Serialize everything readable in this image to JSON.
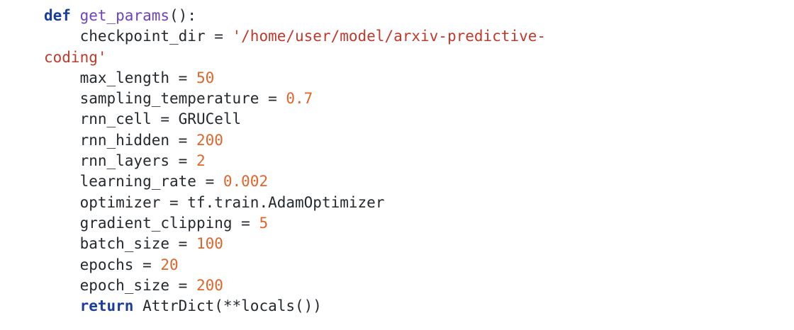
{
  "editor": {
    "lines": [
      {
        "indent": "",
        "tokens": [
          {
            "type": "kw",
            "text": "def"
          },
          {
            "type": "plain",
            "text": " "
          },
          {
            "type": "fn",
            "text": "get_params"
          },
          {
            "type": "plain",
            "text": "():"
          }
        ]
      },
      {
        "indent": "    ",
        "tokens": [
          {
            "type": "plain",
            "text": "checkpoint_dir = "
          },
          {
            "type": "str",
            "text": "'/home/user/model/arxiv-predictive-"
          }
        ]
      },
      {
        "indent": "",
        "tokens": [
          {
            "type": "str",
            "text": "coding'"
          }
        ]
      },
      {
        "indent": "    ",
        "tokens": [
          {
            "type": "plain",
            "text": "max_length = "
          },
          {
            "type": "num",
            "text": "50"
          }
        ]
      },
      {
        "indent": "    ",
        "tokens": [
          {
            "type": "plain",
            "text": "sampling_temperature = "
          },
          {
            "type": "num",
            "text": "0.7"
          }
        ]
      },
      {
        "indent": "    ",
        "tokens": [
          {
            "type": "plain",
            "text": "rnn_cell = GRUCell"
          }
        ]
      },
      {
        "indent": "    ",
        "tokens": [
          {
            "type": "plain",
            "text": "rnn_hidden = "
          },
          {
            "type": "num",
            "text": "200"
          }
        ]
      },
      {
        "indent": "    ",
        "tokens": [
          {
            "type": "plain",
            "text": "rnn_layers = "
          },
          {
            "type": "num",
            "text": "2"
          }
        ]
      },
      {
        "indent": "    ",
        "tokens": [
          {
            "type": "plain",
            "text": "learning_rate = "
          },
          {
            "type": "num",
            "text": "0.002"
          }
        ]
      },
      {
        "indent": "    ",
        "tokens": [
          {
            "type": "plain",
            "text": "optimizer = tf.train.AdamOptimizer"
          }
        ]
      },
      {
        "indent": "    ",
        "tokens": [
          {
            "type": "plain",
            "text": "gradient_clipping = "
          },
          {
            "type": "num",
            "text": "5"
          }
        ]
      },
      {
        "indent": "    ",
        "tokens": [
          {
            "type": "plain",
            "text": "batch_size = "
          },
          {
            "type": "num",
            "text": "100"
          }
        ]
      },
      {
        "indent": "    ",
        "tokens": [
          {
            "type": "plain",
            "text": "epochs = "
          },
          {
            "type": "num",
            "text": "20"
          }
        ]
      },
      {
        "indent": "    ",
        "tokens": [
          {
            "type": "plain",
            "text": "epoch_size = "
          },
          {
            "type": "num",
            "text": "200"
          }
        ]
      },
      {
        "indent": "    ",
        "tokens": [
          {
            "type": "kw",
            "text": "return"
          },
          {
            "type": "plain",
            "text": " AttrDict(**locals())"
          }
        ]
      }
    ]
  },
  "colors": {
    "keyword": "#1b3e9c",
    "function": "#6f42c1",
    "string": "#c0392b",
    "number": "#e0652a",
    "text": "#24292e",
    "background": "#ffffff"
  }
}
